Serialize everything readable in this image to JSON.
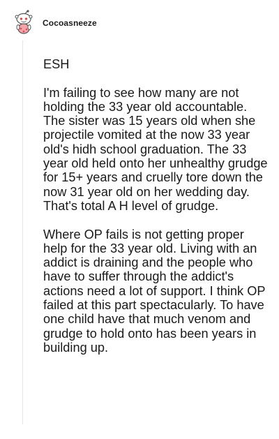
{
  "comment": {
    "author": "Cocoasneeze",
    "paragraphs": [
      "ESH",
      "I'm failing to see how many are not holding the 33 year old accountable. The sister was 15 years old when she projectile vomited at the now 33 year old's hidh school graduation. The 33 year old held onto her unhealthy grudge for 15+ years and cruelly tore down the now 31 year old on her wedding day. That's total A H level of grudge.",
      "Where OP fails is not getting proper help for the 33 year old. Living with an addict is draining and the people who have to suffer through the addict's actions need a lot of support. I think OP failed at this part spectacularly. To have one child have that much venom and grudge to hold onto has been years in building up."
    ]
  },
  "icons": {
    "avatar": "snoo-avatar-icon"
  }
}
